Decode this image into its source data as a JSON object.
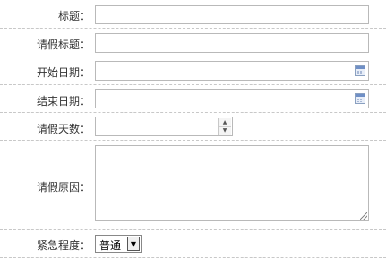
{
  "form": {
    "title": {
      "label": "标题：",
      "value": ""
    },
    "leave_title": {
      "label": "请假标题：",
      "value": ""
    },
    "start_date": {
      "label": "开始日期：",
      "value": ""
    },
    "end_date": {
      "label": "结束日期：",
      "value": ""
    },
    "leave_days": {
      "label": "请假天数：",
      "value": ""
    },
    "leave_reason": {
      "label": "请假原因：",
      "value": ""
    },
    "urgency": {
      "label": "紧急程度：",
      "selected": "普通"
    }
  },
  "icons": {
    "calendar": "calendar-icon",
    "spinner_up": "chevron-up-icon",
    "spinner_down": "chevron-down-icon",
    "select_arrow": "chevron-down-icon"
  }
}
